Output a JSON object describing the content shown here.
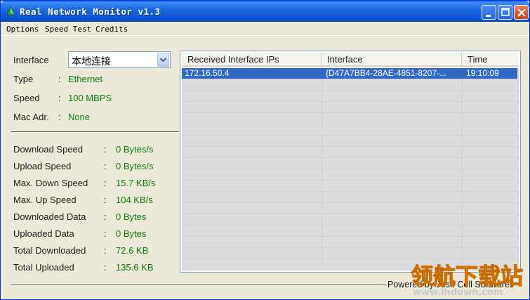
{
  "window": {
    "title": "Real Network Monitor v1.3"
  },
  "menu": [
    "Options",
    "Speed Test",
    "Credits"
  ],
  "interface_info": {
    "interface_label": "Interface",
    "interface_value": "本地连接",
    "type_label": "Type",
    "type_value": "Ethernet",
    "speed_label": "Speed",
    "speed_value": "100 MBPS",
    "mac_label": "Mac Adr.",
    "mac_value": "None"
  },
  "stats": [
    {
      "label": "Download Speed",
      "value": "0 Bytes/s"
    },
    {
      "label": "Upload Speed",
      "value": "0 Bytes/s"
    },
    {
      "label": "Max. Down Speed",
      "value": "15.7 KB/s"
    },
    {
      "label": "Max. Up Speed",
      "value": "104 KB/s"
    },
    {
      "label": "Downloaded Data",
      "value": "0 Bytes"
    },
    {
      "label": "Uploaded Data",
      "value": "0 Bytes"
    },
    {
      "label": "Total Downloaded",
      "value": "72.6 KB"
    },
    {
      "label": "Total Uploaded",
      "value": "135.6 KB"
    }
  ],
  "table": {
    "columns": [
      "Received Interface IPs",
      "Interface",
      "Time"
    ],
    "rows": [
      {
        "ip": "172.16.50.4",
        "interface": "{D47A7BB4-28AE-4851-8207-...",
        "time": "19:10:09"
      }
    ]
  },
  "footer": {
    "powered_by": "Powered by Josh Cell Softwares"
  },
  "watermark": {
    "text": "领航下载站",
    "url": "www.lhdown.com"
  },
  "colors": {
    "titlebar": "#0b53d1",
    "value_green": "#0a7a0a",
    "selection": "#316ac5",
    "window_bg": "#ece9d8"
  }
}
